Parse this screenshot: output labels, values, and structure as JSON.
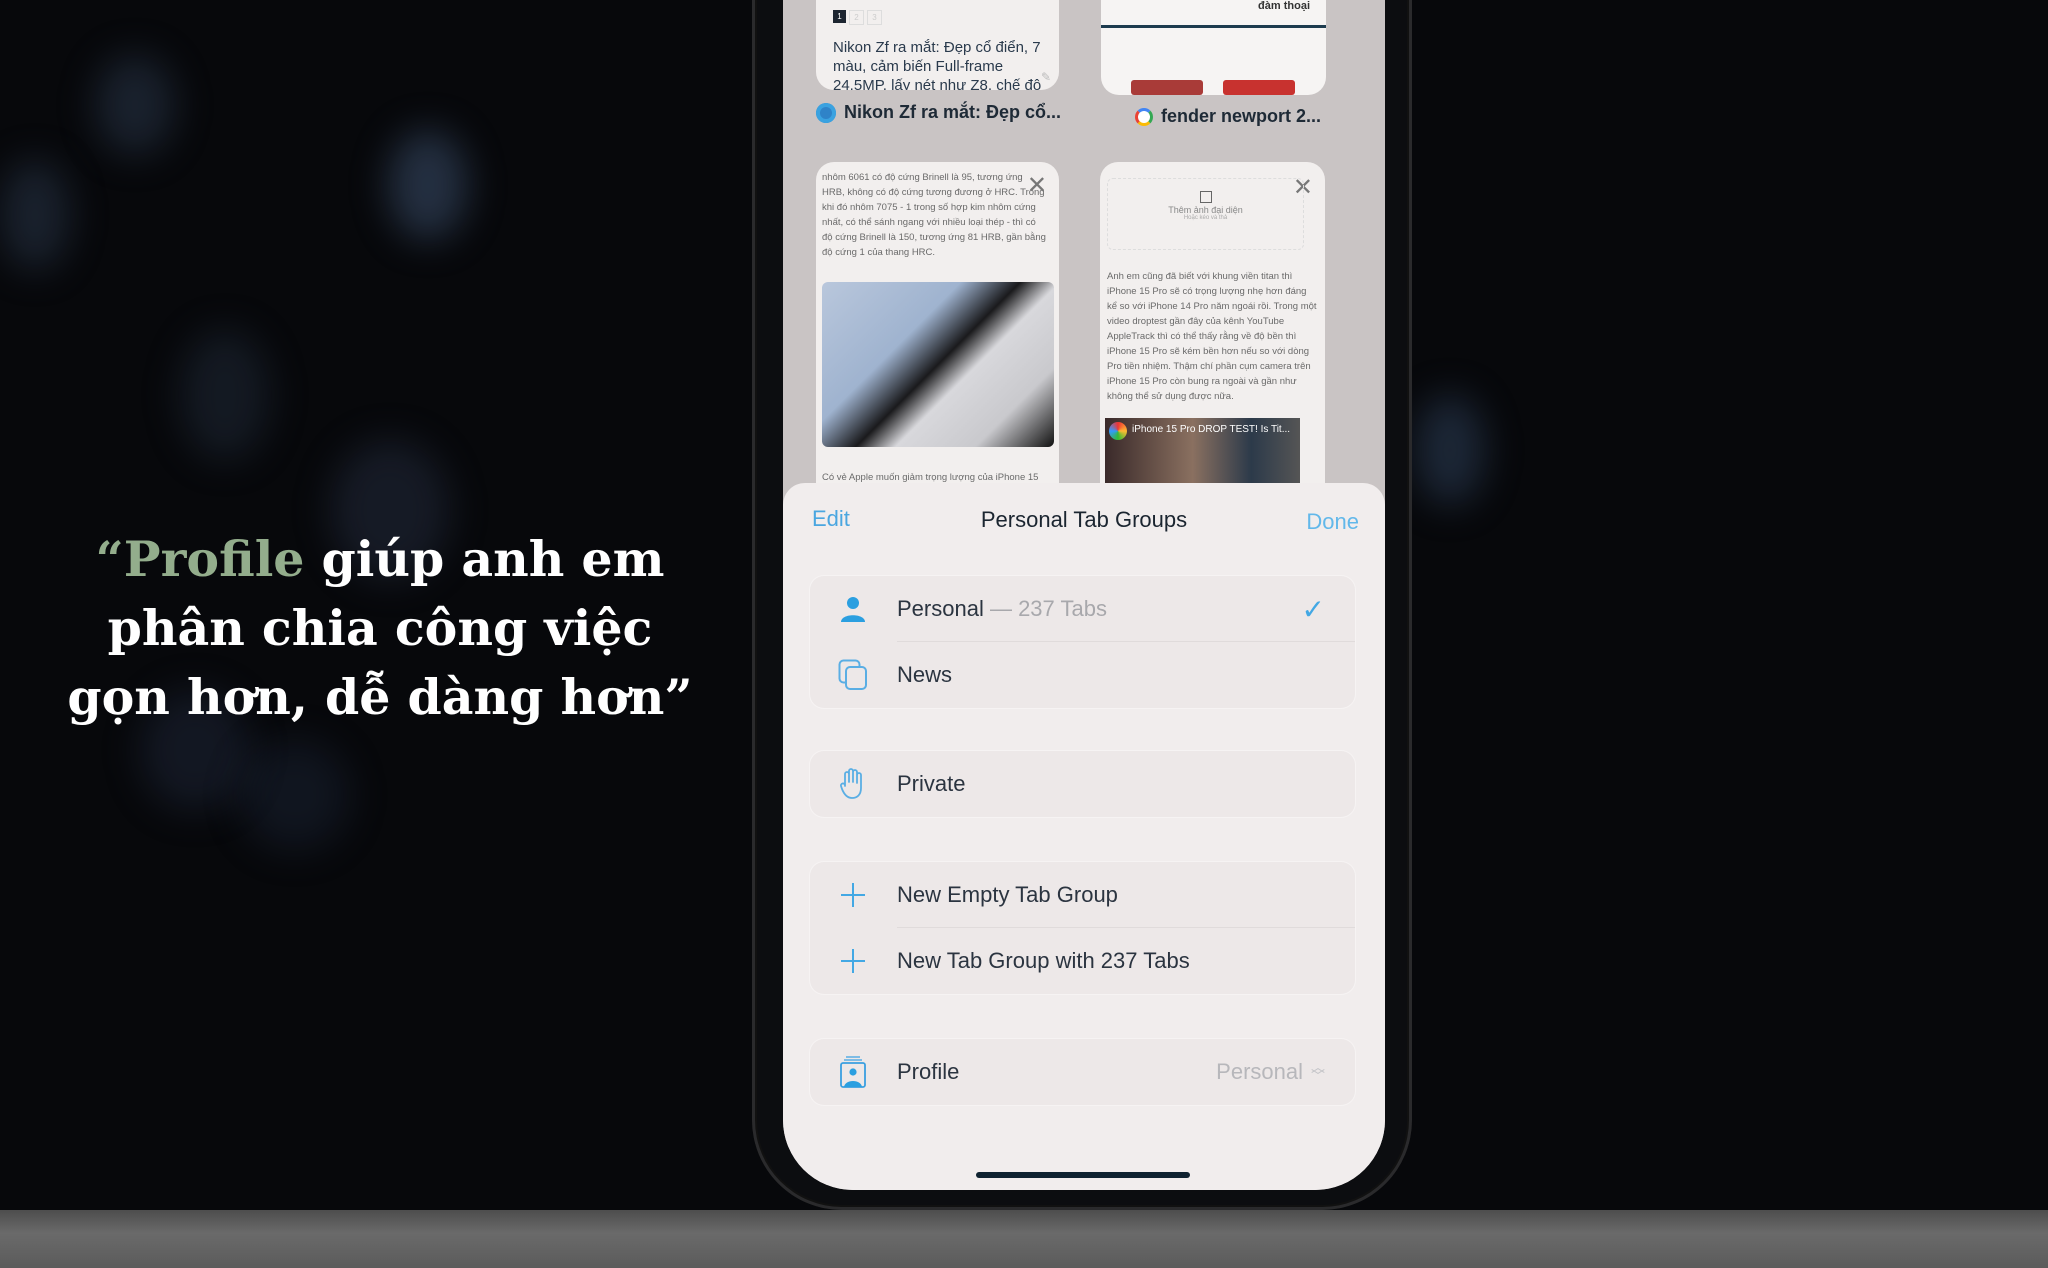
{
  "quote": {
    "open_mark": "“",
    "accent_word": "Profile",
    "line1_rest": " giúp anh em",
    "line2": "phân chia công việc",
    "line3": "gọn hơn, dễ dàng hơn”",
    "accent_color": "#93ad8c"
  },
  "tabs": [
    {
      "title": "Nikon Zf ra mắt: Đẹp cổ...",
      "favicon": "heart-circle-icon",
      "preview_pagination": [
        "1",
        "2",
        "3"
      ],
      "preview_text": "Nikon Zf ra mắt: Đẹp cổ điển, 7 màu, cảm biến Full-frame 24.5MP, lấy nét như Z8, chế độ"
    },
    {
      "title": "fender newport 2...",
      "favicon": "google-icon",
      "preview_text": "đàm thoại"
    },
    {
      "preview_text": "nhôm 6061 có độ cứng Brinell là 95, tương ứng HRB, không có độ cứng tương đương ở HRC. Trong khi đó nhôm 7075 - 1 trong số hợp kim nhôm cứng nhất, có thể sánh ngang với nhiều loại thép - thì có độ cứng Brinell là 150, tương ứng 81 HRB, gần bằng độ cứng 1 của thang HRC.",
      "caption": "Có vẻ Apple muốn giảm trọng lượng của iPhone 15"
    },
    {
      "avatar_placeholder": "Thêm ảnh đại diện",
      "avatar_hint": "Hoặc kéo và thả",
      "preview_text": "Anh em cũng đã biết với khung viền titan thì iPhone 15 Pro sẽ có trọng lượng nhẹ hơn đáng kể so với iPhone 14 Pro năm ngoái rồi. Trong một video droptest gần đây của kênh YouTube AppleTrack thì có thể thấy rằng về độ bền thì iPhone 15 Pro sẽ kém bền hơn nếu so với dòng Pro tiền nhiệm. Thậm chí phần cụm camera trên iPhone 15 Pro còn bung ra ngoài và gần như không thể sử dụng được nữa.",
      "video_title": "iPhone 15 Pro DROP TEST! Is Tit..."
    }
  ],
  "sheet": {
    "edit_label": "Edit",
    "title": "Personal Tab Groups",
    "done_label": "Done",
    "groups": [
      [
        {
          "icon": "person-icon",
          "label": "Personal",
          "sub": " — 237 Tabs",
          "checked": true
        },
        {
          "icon": "tab-group-icon",
          "label": "News"
        }
      ],
      [
        {
          "icon": "hand-raised-icon",
          "label": "Private"
        }
      ],
      [
        {
          "icon": "plus-icon",
          "label": "New Empty Tab Group"
        },
        {
          "icon": "plus-icon",
          "label": "New Tab Group with 237 Tabs"
        }
      ],
      [
        {
          "icon": "profile-icon",
          "label": "Profile",
          "value": "Personal"
        }
      ]
    ]
  },
  "colors": {
    "accent_blue": "#43a8e4",
    "sheet_bg": "#f1eded"
  }
}
